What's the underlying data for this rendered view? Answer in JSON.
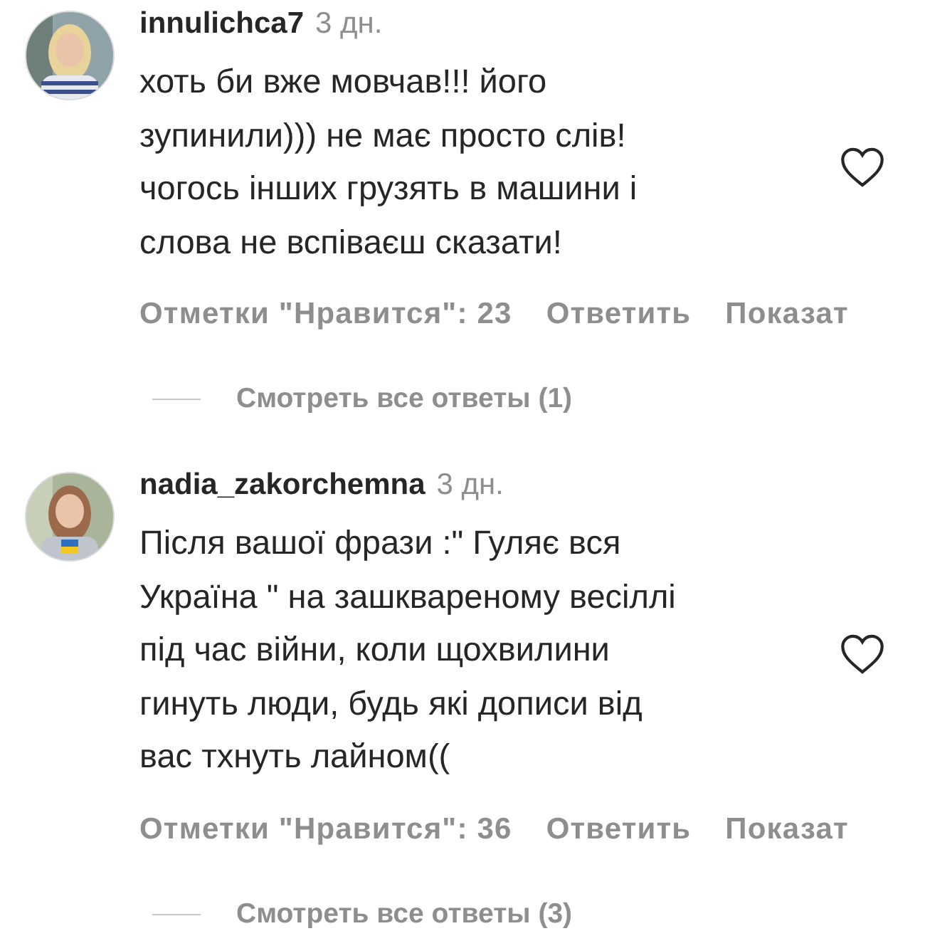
{
  "comments": [
    {
      "username": "innulichca7",
      "time": "3 дн.",
      "text": "хоть би вже мовчав!!! його\nзупинили))) не має просто слів!\nчогось інших грузять в машини і\nслова не вспіваєш сказати!",
      "liked": false,
      "likes": "Отметки \"Нравится\": 23",
      "reply": "Ответить",
      "more": "Показат",
      "view_replies": "Смотреть все ответы (1)"
    },
    {
      "username": "nadia_zakorchemna",
      "time": "3 дн.",
      "text": "Після вашої фрази :\" Гуляє вся\nУкраїна \" на зашквареному весіллі\nпід час війни, коли щохвилини\nгинуть люди, будь які дописи від\nвас тхнуть лайном((",
      "liked": false,
      "likes": "Отметки \"Нравится\": 36",
      "reply": "Ответить",
      "more": "Показат",
      "view_replies": "Смотреть все ответы (3)"
    }
  ]
}
